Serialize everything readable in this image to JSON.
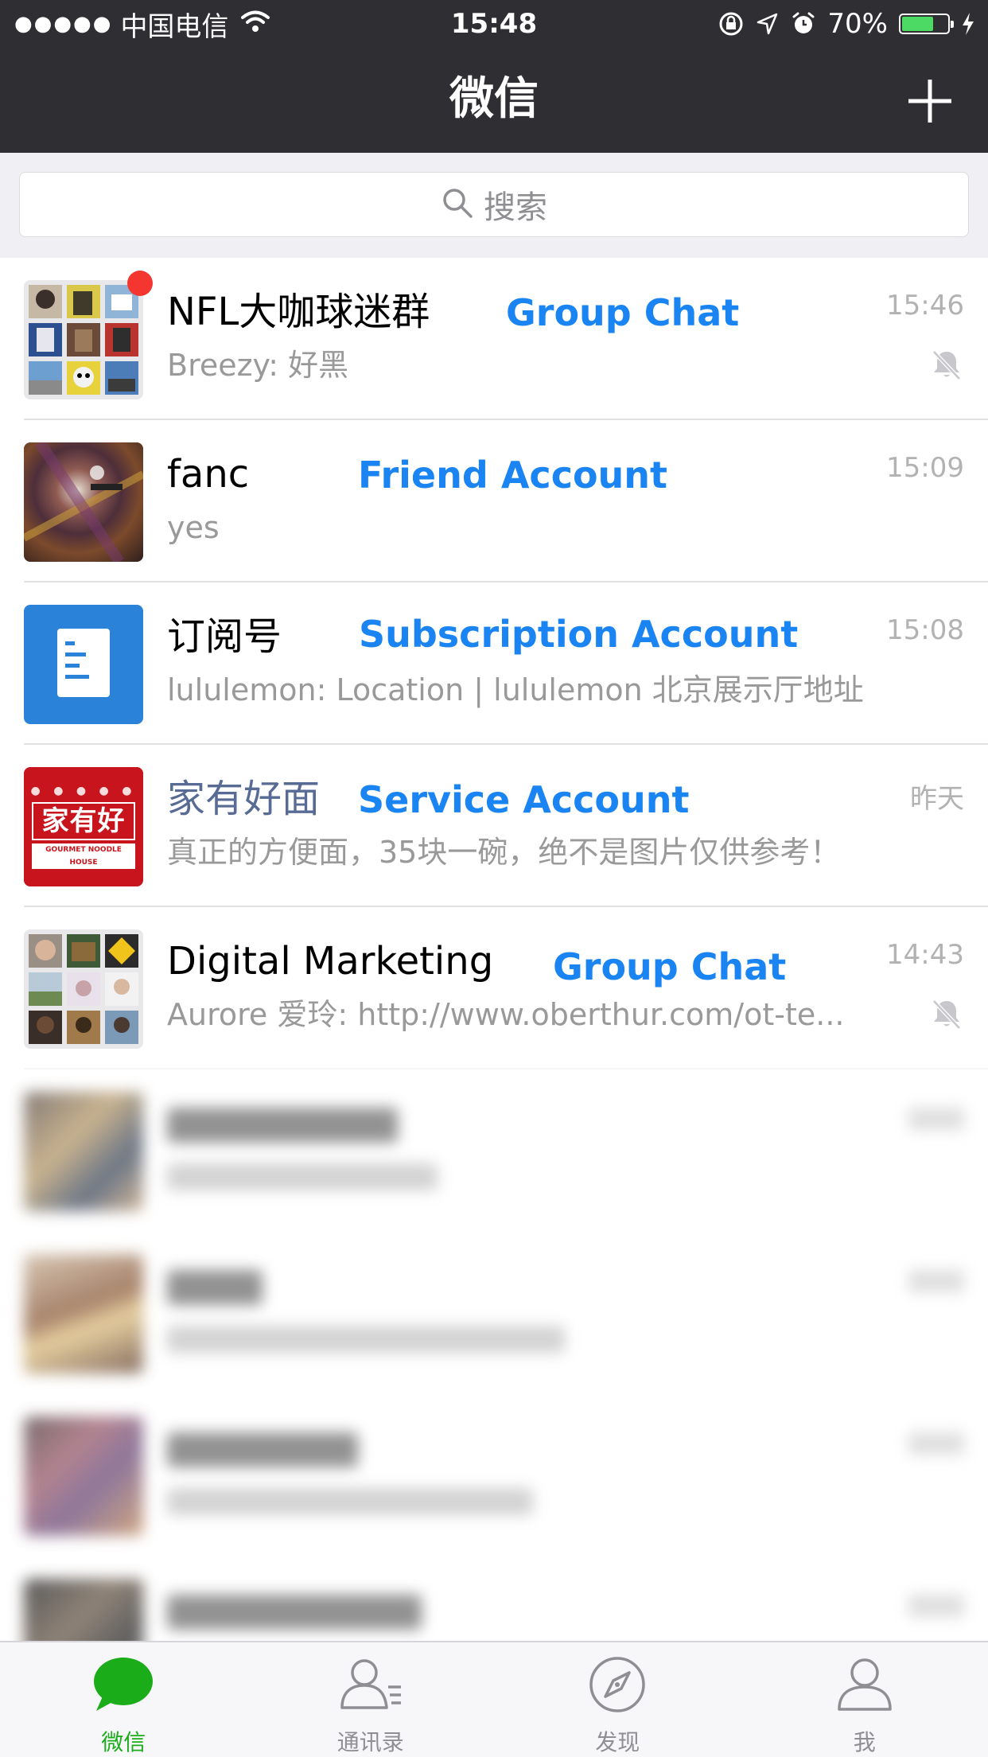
{
  "status_bar": {
    "signal": "●●●●●",
    "carrier": "中国电信",
    "time": "15:48",
    "battery_percent": "70%",
    "battery_level": 0.7
  },
  "nav": {
    "title": "微信",
    "add_icon": "plus-icon"
  },
  "search": {
    "placeholder": "搜索",
    "icon": "search-icon"
  },
  "chats": [
    {
      "name": "NFL大咖球迷群",
      "preview": "Breezy: 好黑",
      "time": "15:46",
      "muted": true,
      "unread": true,
      "annotation": "Group Chat"
    },
    {
      "name": "fanc",
      "preview": "yes",
      "time": "15:09",
      "muted": false,
      "annotation": "Friend Account"
    },
    {
      "name": "订阅号",
      "preview": "lululemon: Location | lululemon 北京展示厅地址",
      "time": "15:08",
      "muted": false,
      "annotation": "Subscription Account",
      "avatar_icon": "document-icon"
    },
    {
      "name": "家有好面",
      "preview": "真正的方便面，35块一碗，绝不是图片仅供参考！",
      "time": "昨天",
      "muted": false,
      "annotation": "Service Account",
      "avatar_text": "家有好面",
      "avatar_subtext": "GOURMET NOODLE HOUSE"
    },
    {
      "name": "Digital Marketing",
      "preview": "Aurore 爱玲: http://www.oberthur.com/ot-te...",
      "time": "14:43",
      "muted": true,
      "annotation": "Group Chat"
    }
  ],
  "tabs": [
    {
      "label": "微信",
      "icon": "chat-bubble-icon",
      "active": true
    },
    {
      "label": "通讯录",
      "icon": "contacts-icon",
      "active": false
    },
    {
      "label": "发现",
      "icon": "compass-icon",
      "active": false
    },
    {
      "label": "我",
      "icon": "person-icon",
      "active": false
    }
  ],
  "colors": {
    "header_bg": "#2f2f33",
    "annotation_blue": "#1a84f2",
    "active_tab_green": "#1aad19",
    "unread_red": "#f43530",
    "account_name": "#576b95"
  }
}
